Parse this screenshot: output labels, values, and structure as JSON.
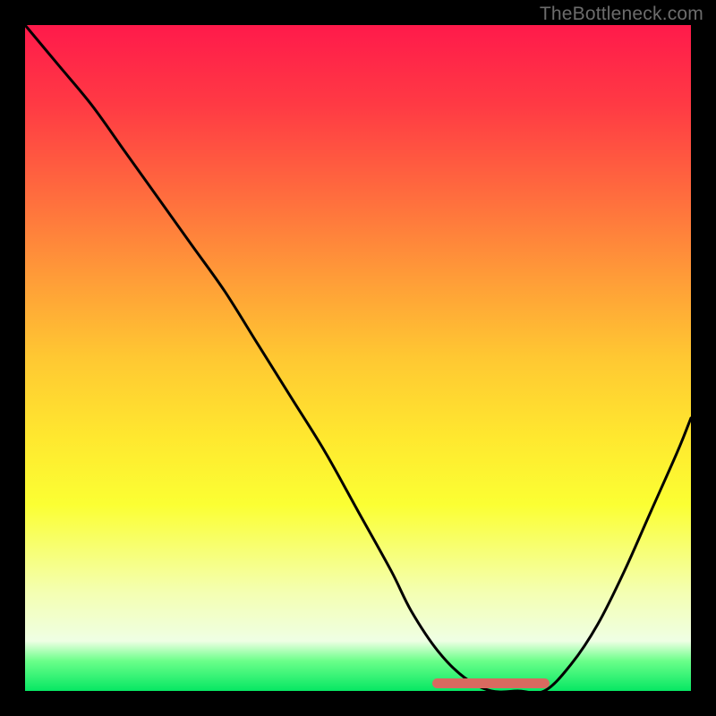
{
  "watermark": "TheBottleneck.com",
  "colors": {
    "background": "#000000",
    "curve": "#000000",
    "marker": "#d86a60"
  },
  "chart_data": {
    "type": "line",
    "title": "",
    "xlabel": "",
    "ylabel": "",
    "xlim": [
      0,
      100
    ],
    "ylim": [
      0,
      100
    ],
    "grid": false,
    "legend": false,
    "annotations": [
      "TheBottleneck.com"
    ],
    "series": [
      {
        "name": "bottleneck-curve",
        "x": [
          0,
          5,
          10,
          15,
          20,
          25,
          30,
          35,
          40,
          45,
          50,
          55,
          58,
          62,
          66,
          70,
          74,
          78,
          82,
          86,
          90,
          94,
          98,
          100
        ],
        "y": [
          100,
          94,
          88,
          81,
          74,
          67,
          60,
          52,
          44,
          36,
          27,
          18,
          12,
          6,
          2,
          0,
          0,
          0,
          4,
          10,
          18,
          27,
          36,
          41
        ]
      }
    ],
    "flat_region": {
      "x_start": 62,
      "x_end": 78,
      "y": 0
    }
  }
}
